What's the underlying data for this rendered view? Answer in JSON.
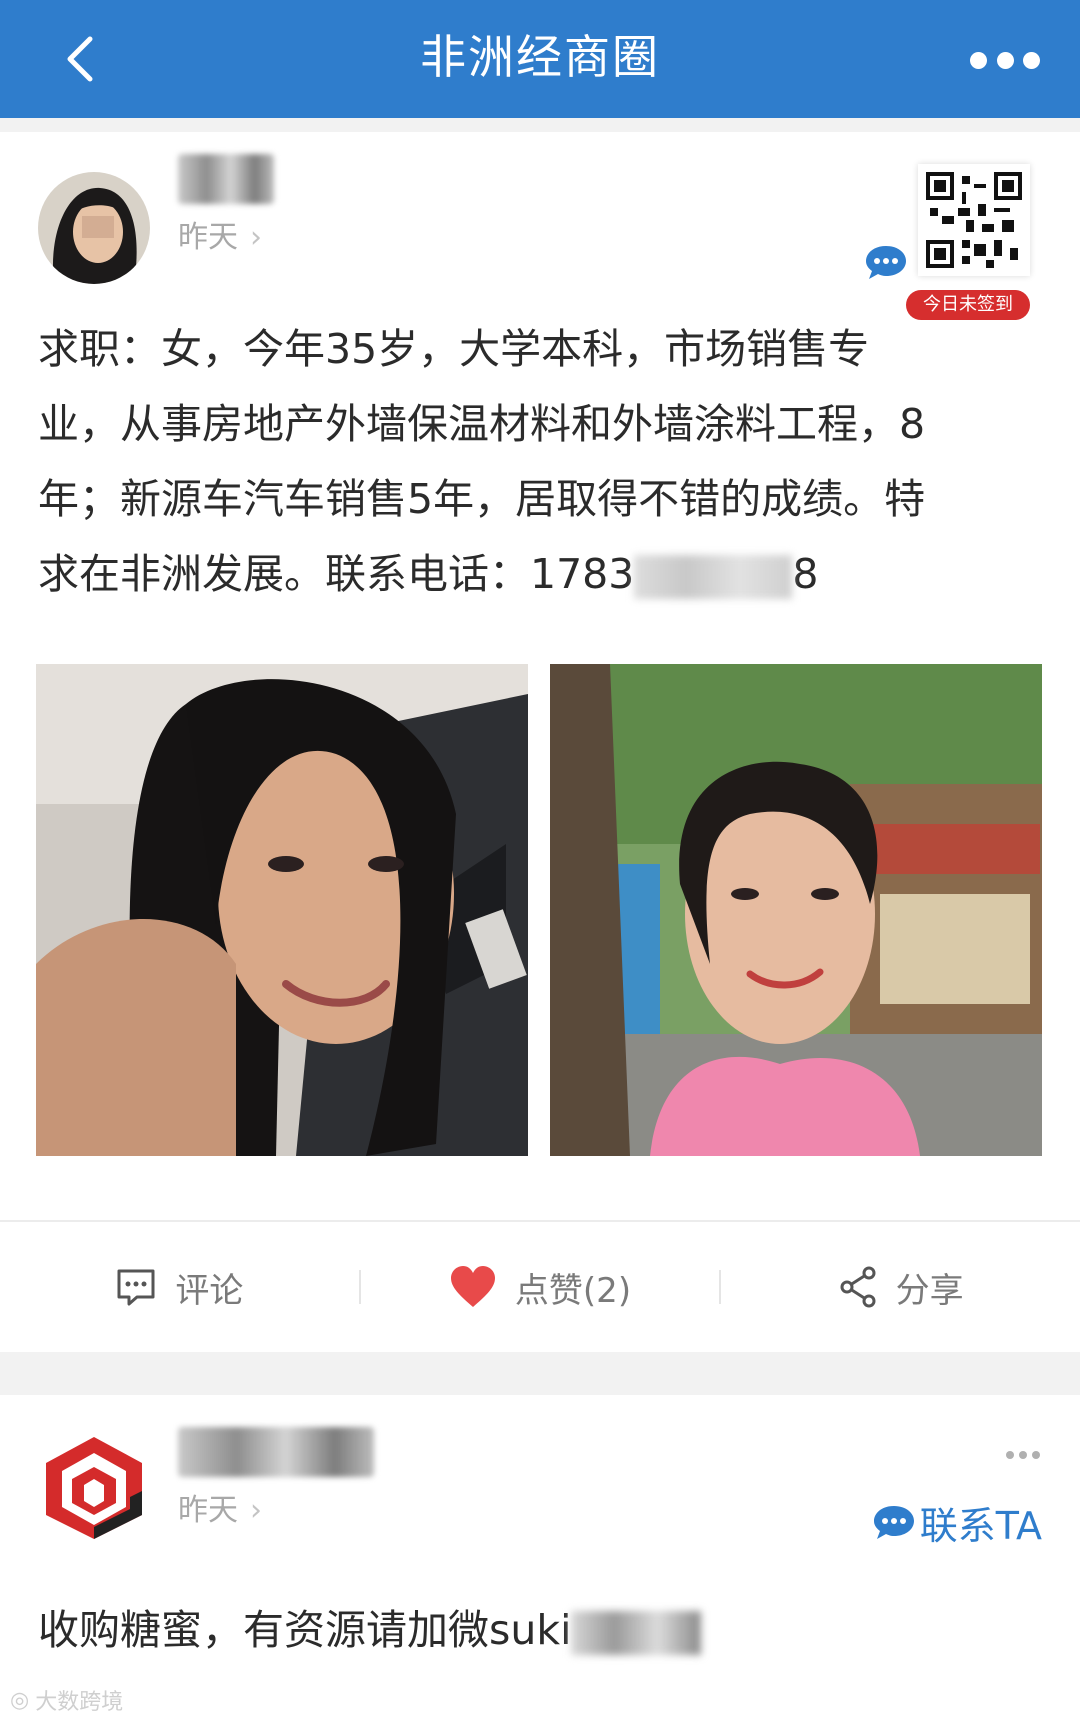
{
  "header": {
    "title": "非洲经商圈",
    "back_icon": "chevron-left-icon",
    "more_icon": "more-dots-icon"
  },
  "posts": [
    {
      "time": "昨天",
      "text_lines": [
        "求职：女，今年35岁，大学本科，市场销售专",
        "业，从事房地产外墙保温材料和外墙涂料工程，8",
        "年；新源车汽车销售5年，居取得不错的成绩。特"
      ],
      "phone_prefix": "求在非洲发展。联系电话：178",
      "phone_visible_start": "3",
      "phone_visible_end": "8",
      "checkin_badge": "今日未签到",
      "actions": {
        "comment": "评论",
        "like": "点赞(2)",
        "share": "分享"
      }
    },
    {
      "time": "昨天",
      "contact": "联系TA",
      "text_prefix": "收购糖蜜，有资源请加微suki"
    }
  ],
  "watermark": "大数跨境",
  "colors": {
    "brand_blue": "#2f7dcc",
    "like_red": "#e84a4a",
    "badge_red": "#d62e2e"
  }
}
